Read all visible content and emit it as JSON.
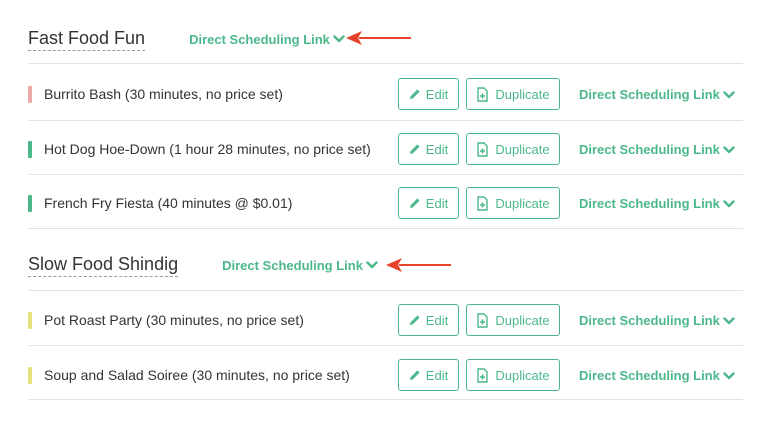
{
  "groups": [
    {
      "title": "Fast Food Fun",
      "link_label": "Direct Scheduling Link",
      "items": [
        {
          "label": "Burrito Bash (30 minutes, no price set)",
          "color": "#f0a9a9"
        },
        {
          "label": "Hot Dog Hoe-Down (1 hour 28 minutes, no price set)",
          "color": "#4cb88a"
        },
        {
          "label": "French Fry Fiesta (40 minutes @ $0.01)",
          "color": "#4cb88a"
        }
      ]
    },
    {
      "title": "Slow Food Shindig",
      "link_label": "Direct Scheduling Link",
      "items": [
        {
          "label": "Pot Roast Party (30 minutes, no price set)",
          "color": "#e6e07a"
        },
        {
          "label": "Soup and Salad Soiree (30 minutes, no price set)",
          "color": "#e6e07a"
        }
      ]
    }
  ],
  "actions": {
    "edit_label": "Edit",
    "duplicate_label": "Duplicate",
    "link_label": "Direct Scheduling Link"
  },
  "colors": {
    "accent": "#4cb88a",
    "arrow": "#e8412c"
  },
  "icons": {
    "edit": "pencil-icon",
    "duplicate": "duplicate-file-icon",
    "link_toggle": "chevron-down-icon",
    "annotation": "red-arrow-pointer"
  }
}
